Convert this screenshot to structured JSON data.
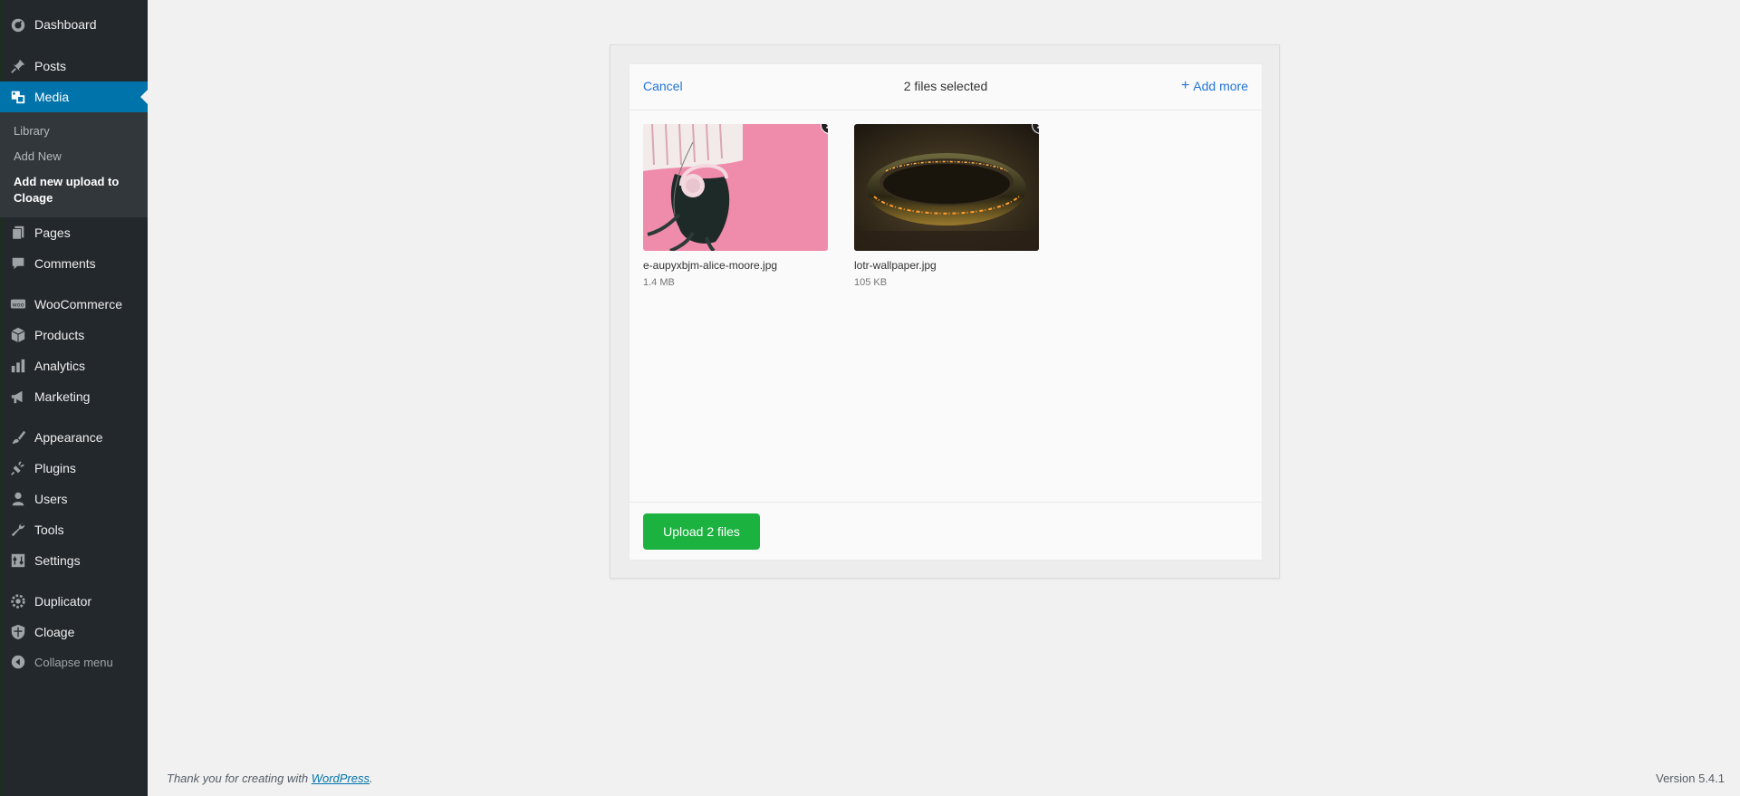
{
  "sidebar": {
    "items": [
      {
        "label": "Dashboard",
        "icon": "dashboard-icon"
      },
      {
        "label": "Posts",
        "icon": "pin-icon"
      },
      {
        "label": "Media",
        "icon": "media-icon",
        "current": true
      },
      {
        "label": "Pages",
        "icon": "pages-icon"
      },
      {
        "label": "Comments",
        "icon": "comment-icon"
      },
      {
        "label": "WooCommerce",
        "icon": "woo-icon"
      },
      {
        "label": "Products",
        "icon": "box-icon"
      },
      {
        "label": "Analytics",
        "icon": "bar-chart-icon"
      },
      {
        "label": "Marketing",
        "icon": "megaphone-icon"
      },
      {
        "label": "Appearance",
        "icon": "brush-icon"
      },
      {
        "label": "Plugins",
        "icon": "plug-icon"
      },
      {
        "label": "Users",
        "icon": "user-icon"
      },
      {
        "label": "Tools",
        "icon": "wrench-icon"
      },
      {
        "label": "Settings",
        "icon": "sliders-icon"
      },
      {
        "label": "Duplicator",
        "icon": "gear-icon"
      },
      {
        "label": "Cloage",
        "icon": "shield-icon"
      }
    ],
    "submenu": [
      "Library",
      "Add New",
      "Add new upload to Cloage"
    ],
    "collapse_label": "Collapse menu"
  },
  "uploader": {
    "cancel_label": "Cancel",
    "status": "2 files selected",
    "add_more_label": "Add more",
    "files": [
      {
        "name": "e-aupyxbjm-alice-moore.jpg",
        "size": "1.4 MB"
      },
      {
        "name": "lotr-wallpaper.jpg",
        "size": "105 KB"
      }
    ],
    "upload_label": "Upload 2 files"
  },
  "footer": {
    "thanks_prefix": "Thank you for creating with ",
    "wordpress_link": "WordPress",
    "thanks_suffix": ".",
    "version": "Version 5.4.1"
  },
  "colors": {
    "sidebar_bg": "#23282d",
    "submenu_bg": "#32373c",
    "current_bg": "#0073aa",
    "link_blue": "#2275d7",
    "upload_green": "#1bb240"
  }
}
